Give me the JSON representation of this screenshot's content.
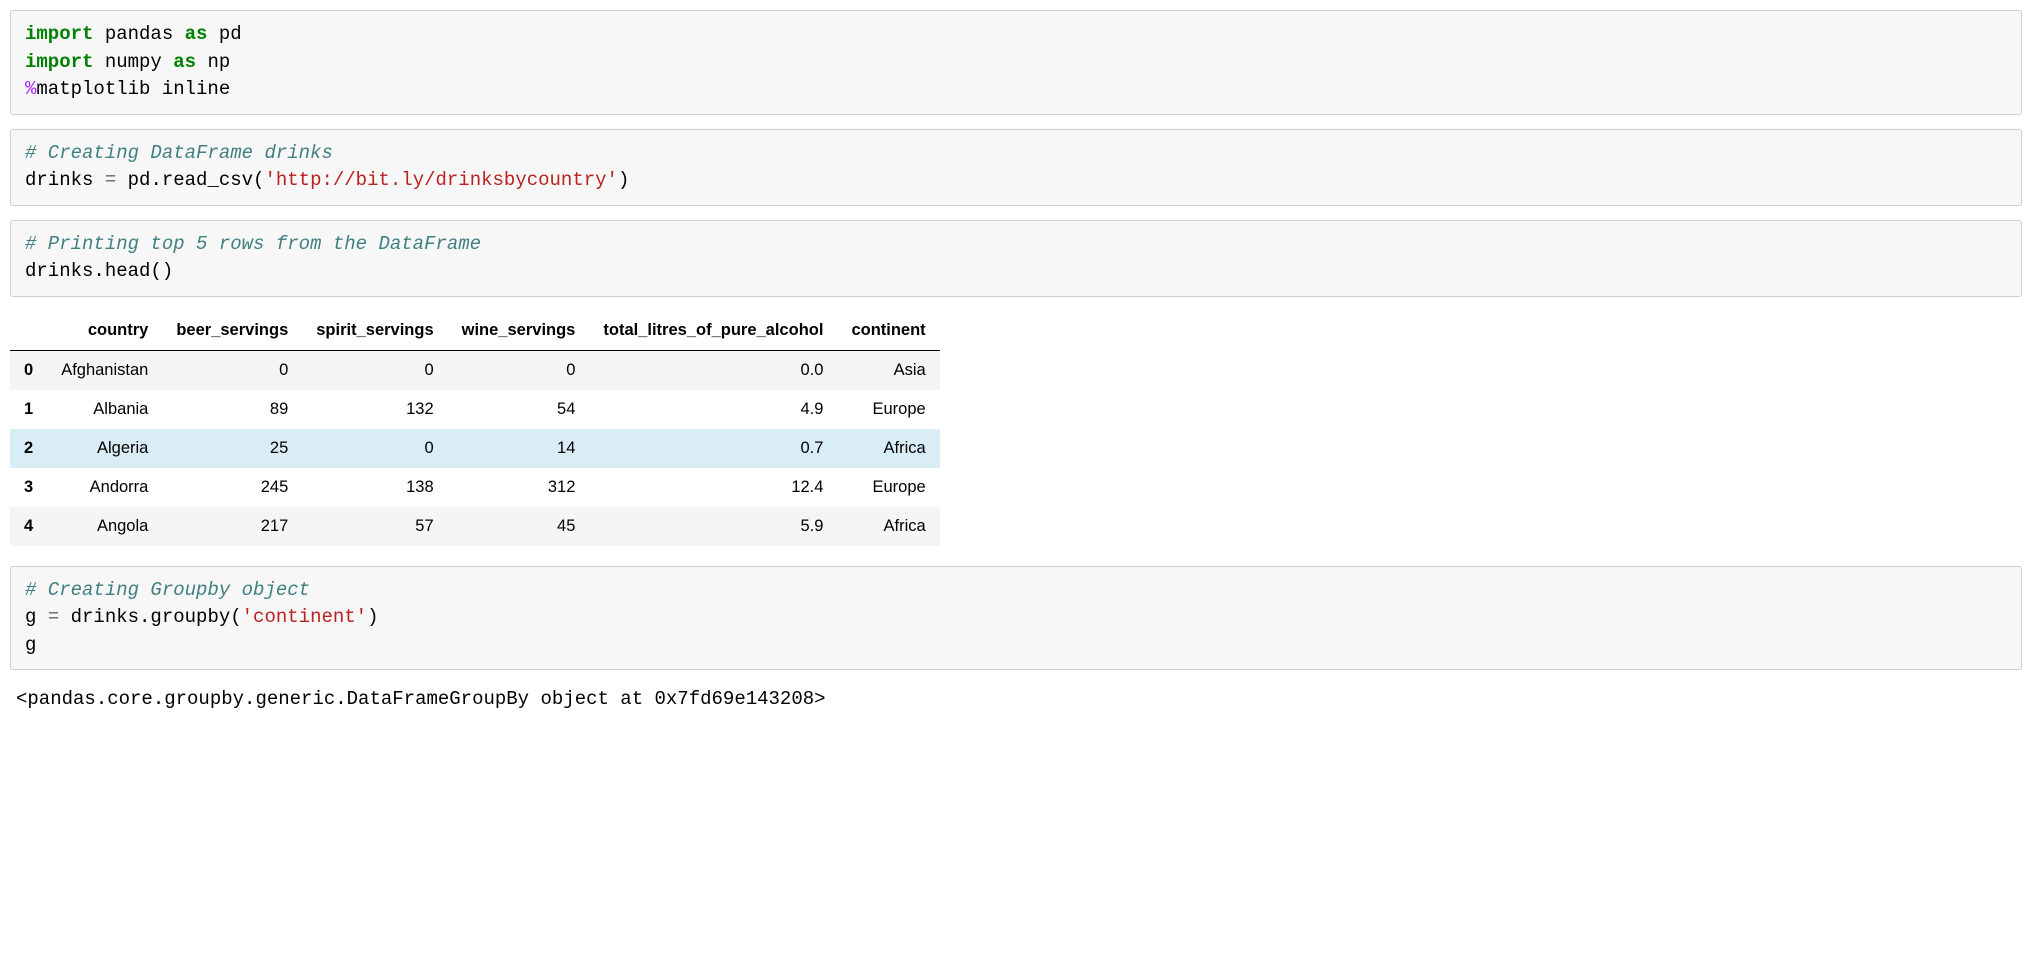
{
  "cell1": {
    "l1_kw1": "import",
    "l1_mod": " pandas ",
    "l1_kw2": "as",
    "l1_alias": " pd",
    "l2_kw1": "import",
    "l2_mod": " numpy ",
    "l2_kw2": "as",
    "l2_alias": " np",
    "l3_mag": "%",
    "l3_rest": "matplotlib inline"
  },
  "cell2": {
    "comment": "# Creating DataFrame drinks",
    "code_a": "drinks ",
    "op": "=",
    "code_b": " pd.read_csv(",
    "str": "'http://bit.ly/drinksbycountry'",
    "code_c": ")"
  },
  "cell3": {
    "comment": "# Printing top 5 rows from the DataFrame",
    "code": "drinks.head()"
  },
  "table": {
    "headers": [
      "",
      "country",
      "beer_servings",
      "spirit_servings",
      "wine_servings",
      "total_litres_of_pure_alcohol",
      "continent"
    ],
    "rows": [
      {
        "idx": "0",
        "country": "Afghanistan",
        "beer": "0",
        "spirit": "0",
        "wine": "0",
        "total": "0.0",
        "continent": "Asia",
        "hl": false
      },
      {
        "idx": "1",
        "country": "Albania",
        "beer": "89",
        "spirit": "132",
        "wine": "54",
        "total": "4.9",
        "continent": "Europe",
        "hl": false
      },
      {
        "idx": "2",
        "country": "Algeria",
        "beer": "25",
        "spirit": "0",
        "wine": "14",
        "total": "0.7",
        "continent": "Africa",
        "hl": true
      },
      {
        "idx": "3",
        "country": "Andorra",
        "beer": "245",
        "spirit": "138",
        "wine": "312",
        "total": "12.4",
        "continent": "Europe",
        "hl": false
      },
      {
        "idx": "4",
        "country": "Angola",
        "beer": "217",
        "spirit": "57",
        "wine": "45",
        "total": "5.9",
        "continent": "Africa",
        "hl": false
      }
    ]
  },
  "cell4": {
    "comment": "# Creating Groupby object",
    "l2_a": "g ",
    "l2_op": "=",
    "l2_b": " drinks.groupby(",
    "l2_str": "'continent'",
    "l2_c": ")",
    "l3": "g"
  },
  "output4": "<pandas.core.groupby.generic.DataFrameGroupBy object at 0x7fd69e143208>"
}
